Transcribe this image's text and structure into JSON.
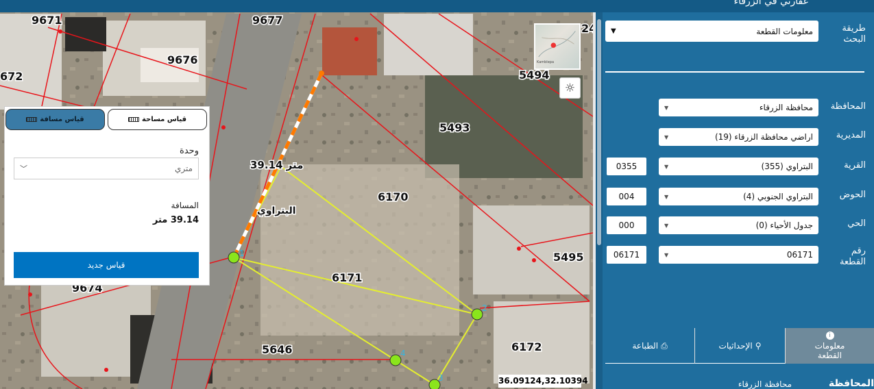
{
  "header": {
    "title": "عقارتي في الزرقاء"
  },
  "map": {
    "parcels": [
      {
        "label": "9671"
      },
      {
        "label": "9677"
      },
      {
        "label": "9676"
      },
      {
        "label": "672"
      },
      {
        "label": "5494"
      },
      {
        "label": "5493"
      },
      {
        "label": "6170"
      },
      {
        "label": "6171"
      },
      {
        "label": "5495"
      },
      {
        "label": "9674"
      },
      {
        "label": "5646"
      },
      {
        "label": "6172"
      },
      {
        "label": "24"
      }
    ],
    "measure_label": "39.14 متر",
    "area_name": "البتراوي",
    "points": [
      "1",
      "2",
      "3",
      "4"
    ],
    "coordinates": "36.09124,32.10394",
    "minimap_caption": "Kamblepa",
    "sun_icon": "sun-icon"
  },
  "measure_panel": {
    "distance_tab": "قياس مسافة",
    "area_tab": "قياس مساحة",
    "unit_label": "وحدة",
    "unit_value": "متري",
    "distance_label": "المسافة",
    "distance_value": "39.14 متر",
    "new_measure_button": "قياس جديد"
  },
  "sidebar": {
    "search_method_label": "طريقة البحث",
    "search_method_value": "معلومات القطعة",
    "fields": [
      {
        "label": "المحافظة",
        "value": "محافظة الزرقاء",
        "code": ""
      },
      {
        "label": "المديرية",
        "value": "اراضي محافظة الزرقاء (19)",
        "code": ""
      },
      {
        "label": "القرية",
        "value": "البتراوي (355)",
        "code": "0355"
      },
      {
        "label": "الحوض",
        "value": "البتراوي الجنوبي (4)",
        "code": "004"
      },
      {
        "label": "الحي",
        "value": "جدول الأحياء (0)",
        "code": "000"
      },
      {
        "label": "رقم القطعة",
        "value": "06171",
        "code": "06171"
      }
    ],
    "tabs": {
      "info": "معلومات القطعة",
      "coords": "الإحداثيات",
      "print": "الطباعة"
    },
    "bottom": {
      "label": "المحافظة",
      "value": "محافظة الزرقاء"
    }
  },
  "colors": {
    "panel_bg": "#1f6e9e",
    "primary_button": "#0074c2",
    "parcel_line": "#e8141a",
    "measure_line": "#ff7a00",
    "polygon_line": "#e5ef2e"
  }
}
